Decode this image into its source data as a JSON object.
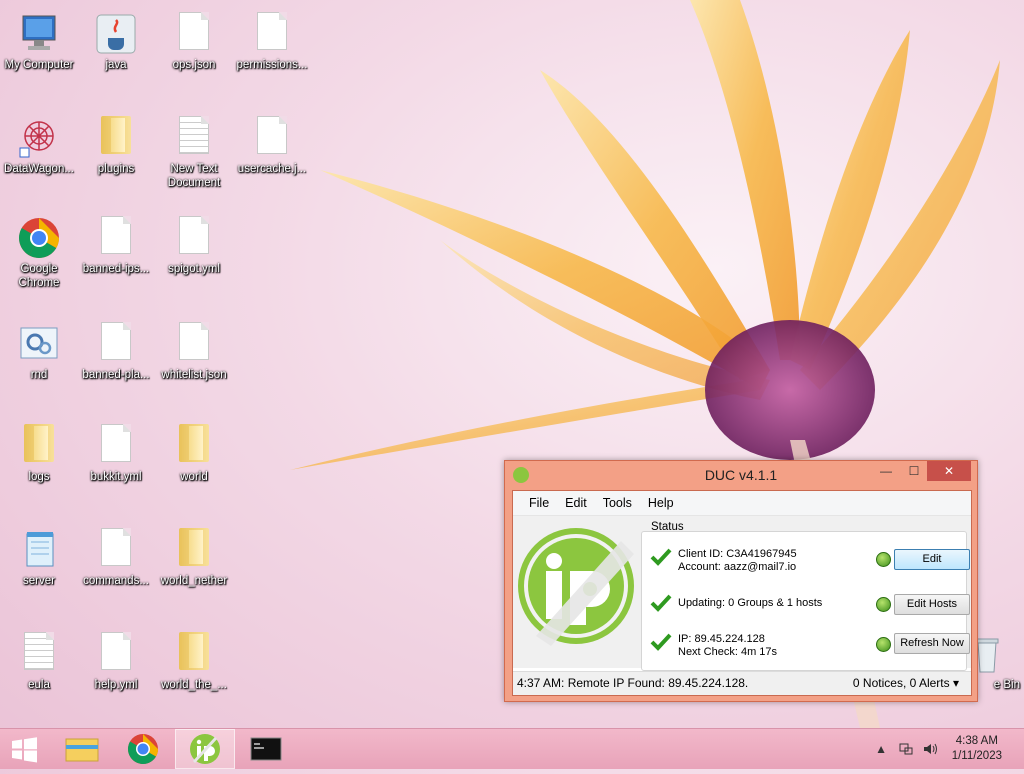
{
  "desktop": {
    "icons": [
      {
        "label": "My Computer"
      },
      {
        "label": "java"
      },
      {
        "label": "ops.json"
      },
      {
        "label": "permissions..."
      },
      {
        "label": "DataWagon..."
      },
      {
        "label": "plugins"
      },
      {
        "label": "New Text Document"
      },
      {
        "label": "usercache.j..."
      },
      {
        "label": "Google Chrome"
      },
      {
        "label": "banned-ips..."
      },
      {
        "label": "spigot.yml"
      },
      {
        "label": "rnd"
      },
      {
        "label": "banned-pla..."
      },
      {
        "label": "whitelist.json"
      },
      {
        "label": "logs"
      },
      {
        "label": "bukkit.yml"
      },
      {
        "label": "world"
      },
      {
        "label": "server"
      },
      {
        "label": "commands..."
      },
      {
        "label": "world_nether"
      },
      {
        "label": "eula"
      },
      {
        "label": "help.yml"
      },
      {
        "label": "world_the_..."
      },
      {
        "label": "e Bin"
      }
    ]
  },
  "duc": {
    "title": "DUC v4.1.1",
    "controls": {
      "minimize": "—",
      "maximize": "☐",
      "close": "✕"
    },
    "menu": [
      "File",
      "Edit",
      "Tools",
      "Help"
    ],
    "status_group": "Status",
    "rows": [
      {
        "line1": "Client ID: C3A41967945",
        "line2": "Account: aazz@mail7.io",
        "button": "Edit"
      },
      {
        "line1": "Updating: 0 Groups & 1 hosts",
        "line2": "",
        "button": "Edit Hosts"
      },
      {
        "line1": "IP: 89.45.224.128",
        "line2": "Next Check: 4m 17s",
        "button": "Refresh Now"
      }
    ],
    "statusbar": {
      "left": "4:37 AM: Remote IP Found: 89.45.224.128.",
      "right": "0 Notices, 0 Alerts  ▾"
    }
  },
  "taskbar": {
    "clock_time": "4:38 AM",
    "clock_date": "1/11/2023",
    "tray_up": "▲"
  },
  "colors": {
    "window_frame": "#f3a086",
    "close_button": "#c7504a",
    "taskbar": "#eaa8bd",
    "logo_green": "#8cc63f"
  }
}
